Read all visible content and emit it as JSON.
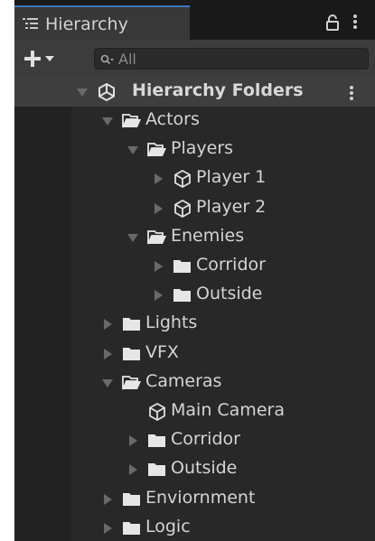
{
  "tab": {
    "title": "Hierarchy",
    "icon": "hierarchy-list-icon"
  },
  "toolbar": {
    "add_icon": "plus-icon",
    "search_placeholder": "All",
    "search_value": ""
  },
  "scene": {
    "name": "Hierarchy Folders",
    "icon": "unity-scene-icon"
  },
  "tree": [
    {
      "label": "Actors",
      "depth": 1,
      "expanded": true,
      "kind": "folder-open"
    },
    {
      "label": "Players",
      "depth": 2,
      "expanded": true,
      "kind": "folder-open"
    },
    {
      "label": "Player 1",
      "depth": 3,
      "expanded": false,
      "kind": "gameobject"
    },
    {
      "label": "Player 2",
      "depth": 3,
      "expanded": false,
      "kind": "gameobject"
    },
    {
      "label": "Enemies",
      "depth": 2,
      "expanded": true,
      "kind": "folder-open"
    },
    {
      "label": "Corridor",
      "depth": 3,
      "expanded": false,
      "kind": "folder"
    },
    {
      "label": "Outside",
      "depth": 3,
      "expanded": false,
      "kind": "folder"
    },
    {
      "label": "Lights",
      "depth": 1,
      "expanded": false,
      "kind": "folder"
    },
    {
      "label": "VFX",
      "depth": 1,
      "expanded": false,
      "kind": "folder"
    },
    {
      "label": "Cameras",
      "depth": 1,
      "expanded": true,
      "kind": "folder-open"
    },
    {
      "label": "Main Camera",
      "depth": 2,
      "expanded": null,
      "kind": "gameobject"
    },
    {
      "label": "Corridor",
      "depth": 2,
      "expanded": false,
      "kind": "folder"
    },
    {
      "label": "Outside",
      "depth": 2,
      "expanded": false,
      "kind": "folder"
    },
    {
      "label": "Enviornment",
      "depth": 1,
      "expanded": false,
      "kind": "folder"
    },
    {
      "label": "Logic",
      "depth": 1,
      "expanded": false,
      "kind": "folder"
    }
  ],
  "colors": {
    "panel_bg": "#282828",
    "text": "#d4d4d4",
    "tab_accent": "#3a79bb",
    "arrow": "#6a6a6a"
  }
}
